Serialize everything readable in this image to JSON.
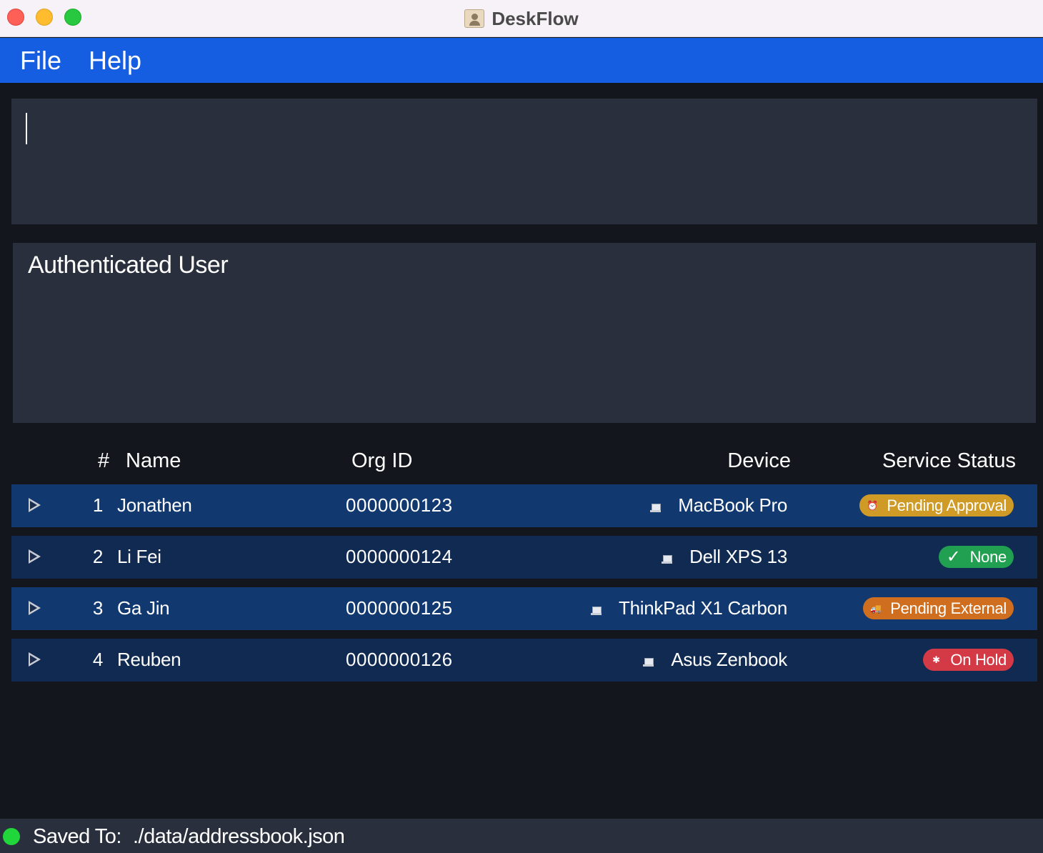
{
  "window": {
    "title": "DeskFlow"
  },
  "menu": {
    "items": [
      {
        "label": "File"
      },
      {
        "label": "Help"
      }
    ]
  },
  "command_box": {
    "value": "",
    "placeholder": ""
  },
  "auth_panel": {
    "title": "Authenticated User"
  },
  "table": {
    "headers": {
      "num": "#",
      "name": "Name",
      "org_id": "Org ID",
      "device": "Device",
      "service_status": "Service Status"
    },
    "rows": [
      {
        "num": "1",
        "name": "Jonathen",
        "org_id": "0000000123",
        "device": "MacBook Pro",
        "status": "Pending Approval",
        "status_icon": "alarm-clock-icon",
        "status_color": "#cf9a26"
      },
      {
        "num": "2",
        "name": "Li Fei",
        "org_id": "0000000124",
        "device": "Dell XPS 13",
        "status": "None",
        "status_icon": "check-icon",
        "status_color": "#21a052"
      },
      {
        "num": "3",
        "name": "Ga Jin",
        "org_id": "0000000125",
        "device": "ThinkPad X1 Carbon",
        "status": "Pending External",
        "status_icon": "truck-icon",
        "status_color": "#cf6e1f"
      },
      {
        "num": "4",
        "name": "Reuben",
        "org_id": "0000000126",
        "device": "Asus Zenbook",
        "status": "On Hold",
        "status_icon": "gear-icon",
        "status_color": "#d43a46"
      }
    ]
  },
  "status_bar": {
    "label": "Saved To:",
    "path": "./data/addressbook.json",
    "indicator_color": "#21d63a"
  },
  "colors": {
    "menu_bar": "#155de1",
    "background": "#13161c",
    "panel": "#2a2f3e",
    "row_odd": "#11386f",
    "row_even": "#112a52"
  }
}
